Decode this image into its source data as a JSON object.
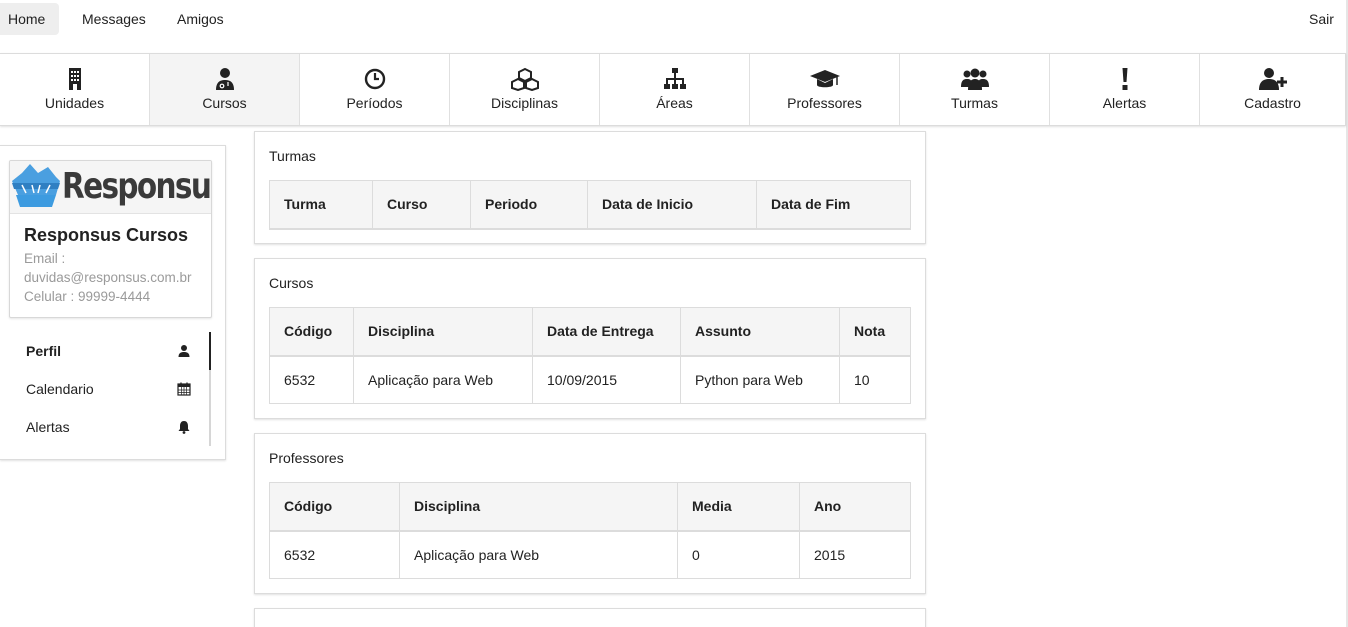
{
  "topnav": {
    "home": "Home",
    "messages": "Messages",
    "amigos": "Amigos",
    "sair": "Sair"
  },
  "iconbar": [
    {
      "label": "Unidades",
      "icon": "building-icon"
    },
    {
      "label": "Cursos",
      "icon": "user-doctor-icon"
    },
    {
      "label": "Períodos",
      "icon": "clock-icon"
    },
    {
      "label": "Disciplinas",
      "icon": "cubes-icon"
    },
    {
      "label": "Áreas",
      "icon": "sitemap-icon"
    },
    {
      "label": "Professores",
      "icon": "graduation-cap-icon"
    },
    {
      "label": "Turmas",
      "icon": "users-icon"
    },
    {
      "label": "Alertas",
      "icon": "exclamation-icon"
    },
    {
      "label": "Cadastro",
      "icon": "user-plus-icon"
    }
  ],
  "profile": {
    "logo_text": "Responsus",
    "name": "Responsus Cursos",
    "email_label": "Email :",
    "email": "duvidas@responsus.com.br",
    "phone": "Celular : 99999-4444"
  },
  "side_menu": [
    {
      "label": "Perfil",
      "icon": "user-icon"
    },
    {
      "label": "Calendario",
      "icon": "calendar-icon"
    },
    {
      "label": "Alertas",
      "icon": "bell-icon"
    }
  ],
  "turmas": {
    "title": "Turmas",
    "headers": [
      "Turma",
      "Curso",
      "Periodo",
      "Data de Inicio",
      "Data de Fim"
    ]
  },
  "cursos": {
    "title": "Cursos",
    "headers": [
      "Código",
      "Disciplina",
      "Data de Entrega",
      "Assunto",
      "Nota"
    ],
    "rows": [
      [
        "6532",
        "Aplicação para Web",
        "10/09/2015",
        "Python para Web",
        "10"
      ]
    ]
  },
  "professores": {
    "title": "Professores",
    "headers": [
      "Código",
      "Disciplina",
      "Media",
      "Ano"
    ],
    "rows": [
      [
        "6532",
        "Aplicação para Web",
        "0",
        "2015"
      ]
    ]
  },
  "colors": {
    "text": "#222222",
    "muted": "#9a9a9a",
    "logo_blue": "#3d9be0",
    "header_bg": "#f5f5f5"
  }
}
